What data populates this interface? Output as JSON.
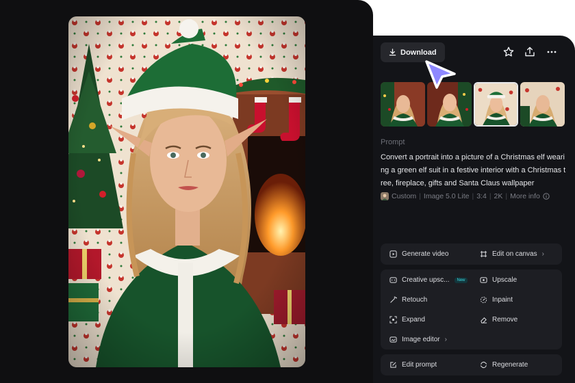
{
  "toolbar": {
    "download_label": "Download",
    "download_icon": "download-icon",
    "favorite_icon": "star-icon",
    "share_icon": "share-icon",
    "more_icon": "more-horizontal-icon"
  },
  "thumbnails": [
    {
      "name": "variation-1",
      "selected": false
    },
    {
      "name": "variation-2",
      "selected": false
    },
    {
      "name": "variation-3",
      "selected": true
    },
    {
      "name": "variation-4",
      "selected": false
    }
  ],
  "prompt": {
    "heading": "Prompt",
    "text": "Convert a portrait into a picture of a Christmas elf wearing a green elf suit in a festive interior with a Christmas tree, fireplace, gifts and Santa Claus wallpaper"
  },
  "meta": {
    "style": "Custom",
    "model": "Image 5.0 Lite",
    "ratio": "3:4",
    "resolution": "2K",
    "more_info": "More info"
  },
  "actions": {
    "generate_video": "Generate video",
    "edit_on_canvas": "Edit on canvas",
    "creative_upscale": "Creative upsc...",
    "new_badge": "New",
    "upscale": "Upscale",
    "retouch": "Retouch",
    "inpaint": "Inpaint",
    "expand": "Expand",
    "remove": "Remove",
    "image_editor": "Image editor",
    "edit_prompt": "Edit prompt",
    "regenerate": "Regenerate"
  },
  "colors": {
    "page_bg": "#0f0f11",
    "panel_bg": "#131418",
    "card_bg": "#1d1e23",
    "button_bg": "#26272c",
    "cursor": "#8e88ff",
    "new_badge": "#3fd8e0"
  }
}
